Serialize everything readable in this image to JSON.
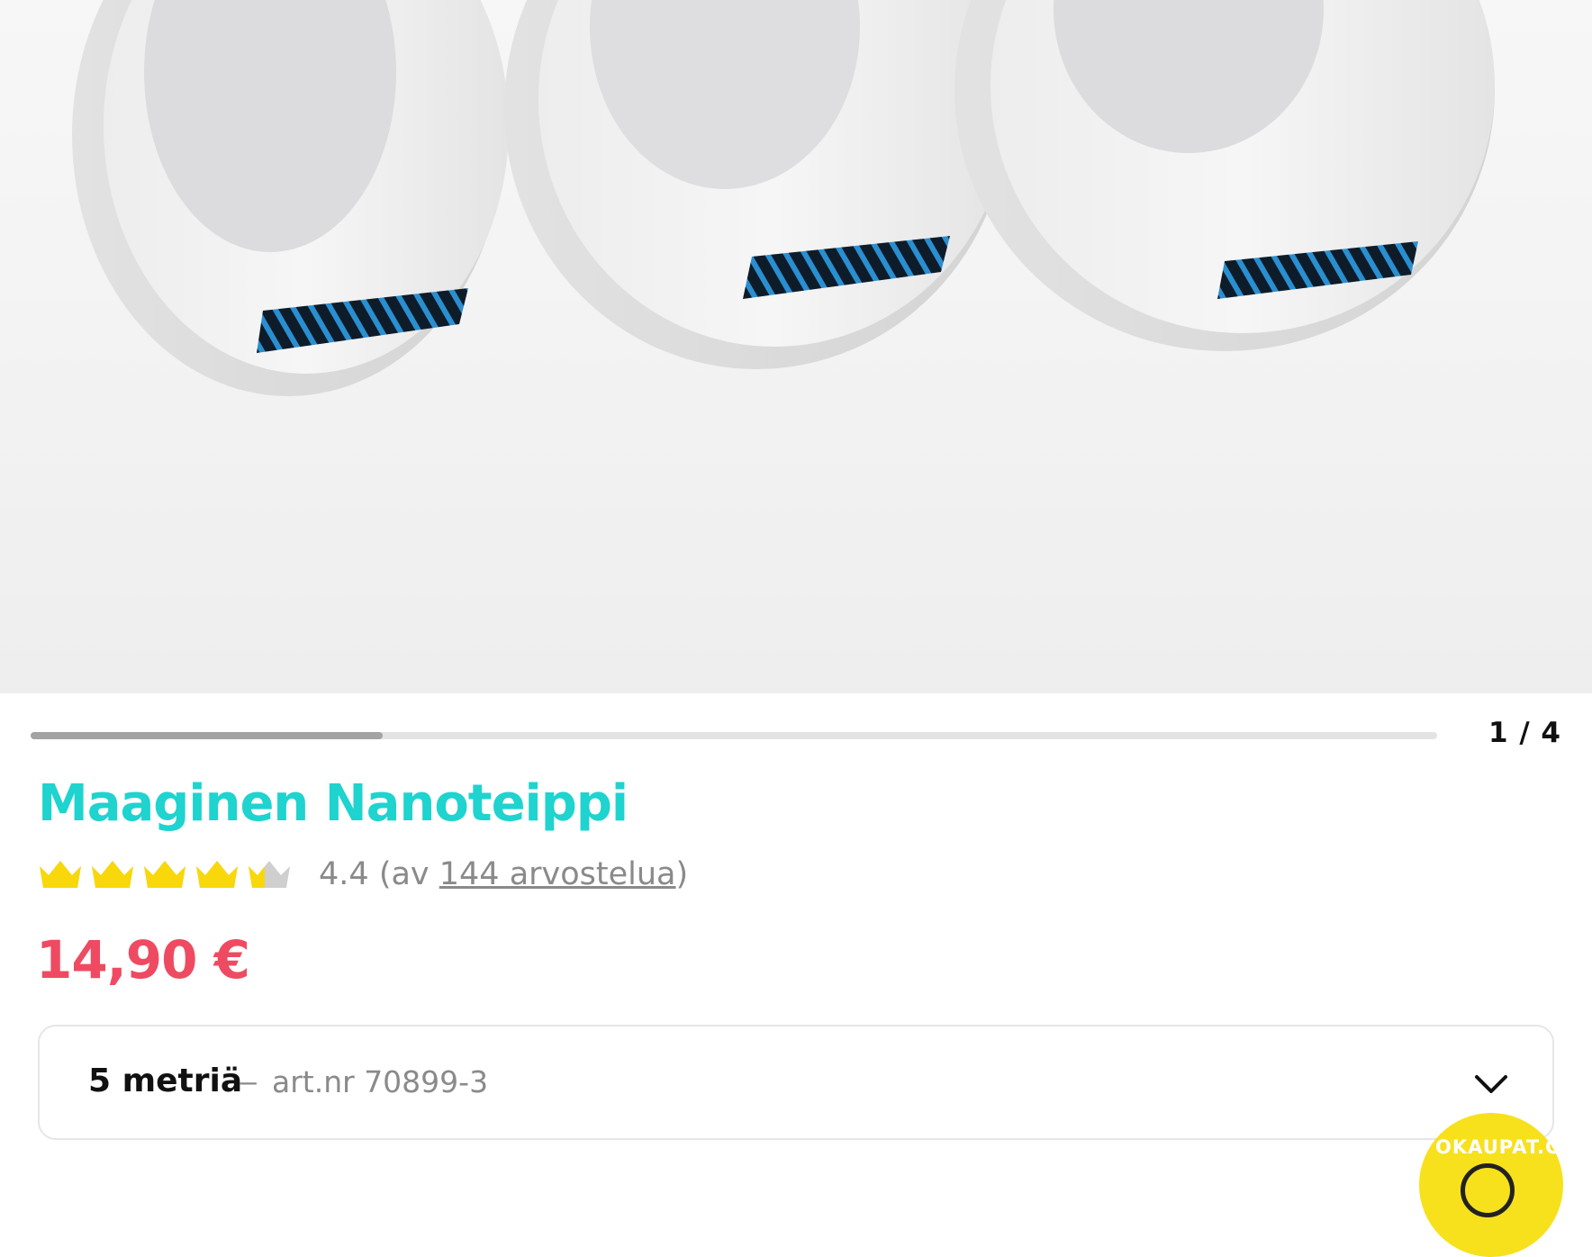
{
  "product": {
    "title": "Maaginen Nanoteippi",
    "rating_value": "4.4",
    "rating_prefix": "(av ",
    "review_link": "144 arvostelua",
    "rating_suffix": ")",
    "rating_stars": 4.4,
    "price": "14,90 €"
  },
  "gallery": {
    "page_indicator": "1 / 4",
    "progress_fraction": 0.25
  },
  "variant": {
    "selected_name": "5 metriä",
    "separator": "–",
    "article": "art.nr 70899-3"
  },
  "badge": {
    "text": "OKAUPAT.CO"
  },
  "icons": {
    "rating": "crown-icon",
    "dropdown": "chevron-down-icon"
  },
  "colors": {
    "title": "#1fd3cf",
    "price": "#ee4b62",
    "crown_filled": "#f8d80a",
    "crown_empty": "#cfcfcf",
    "badge": "#f7e11c"
  }
}
